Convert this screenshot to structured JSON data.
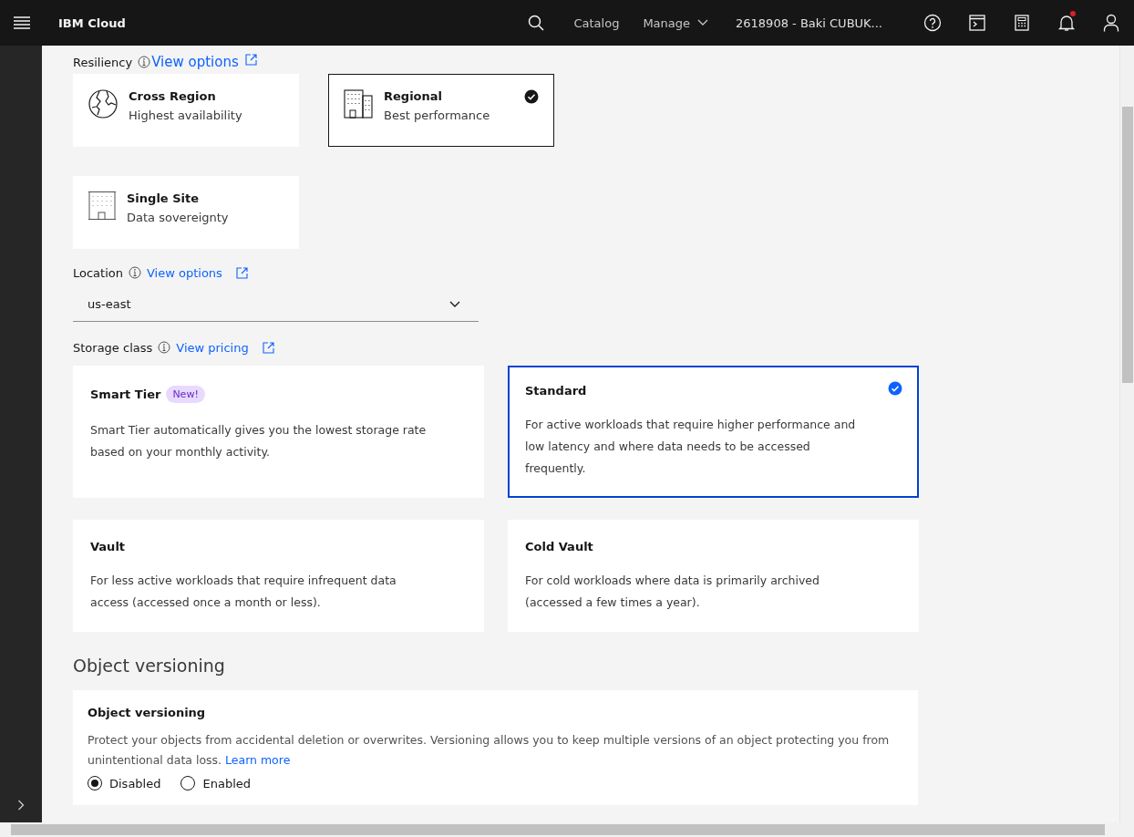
{
  "header": {
    "brand": "IBM Cloud",
    "nav": [
      {
        "label": "Catalog",
        "dropdown": false
      },
      {
        "label": "Manage",
        "dropdown": true
      }
    ],
    "account": "2618908 - Baki CUBUK...",
    "notifications_unread": true
  },
  "resiliency": {
    "label": "Resiliency",
    "link": "View options",
    "options": [
      {
        "kind": "globe",
        "title": "Cross Region",
        "subtitle": "Highest availability",
        "selected": false
      },
      {
        "kind": "buildings",
        "title": "Regional",
        "subtitle": "Best performance",
        "selected": true
      },
      {
        "kind": "building",
        "title": "Single Site",
        "subtitle": "Data sovereignty",
        "selected": false
      }
    ]
  },
  "location": {
    "label": "Location",
    "link": "View options",
    "value": "us-east"
  },
  "storage_class": {
    "label": "Storage class",
    "link": "View pricing",
    "options": [
      {
        "title": "Smart Tier",
        "badge": "New!",
        "description": "Smart Tier automatically gives you the lowest storage rate based on your monthly activity.",
        "selected": false
      },
      {
        "title": "Standard",
        "description": "For active workloads that require higher performance and low latency and where data needs to be accessed frequently.",
        "selected": true
      },
      {
        "title": "Vault",
        "description": "For less active workloads that require infrequent data access (accessed once a month or less).",
        "selected": false
      },
      {
        "title": "Cold Vault",
        "description": "For cold workloads where data is primarily archived (accessed a few times a year).",
        "selected": false
      }
    ]
  },
  "versioning": {
    "section_title": "Object versioning",
    "card_title": "Object versioning",
    "description": "Protect your objects from accidental deletion or overwrites. Versioning allows you to keep multiple versions of an object protecting you from unintentional data loss.",
    "link": "Learn more",
    "options": [
      {
        "label": "Disabled",
        "selected": true
      },
      {
        "label": "Enabled",
        "selected": false
      }
    ]
  }
}
